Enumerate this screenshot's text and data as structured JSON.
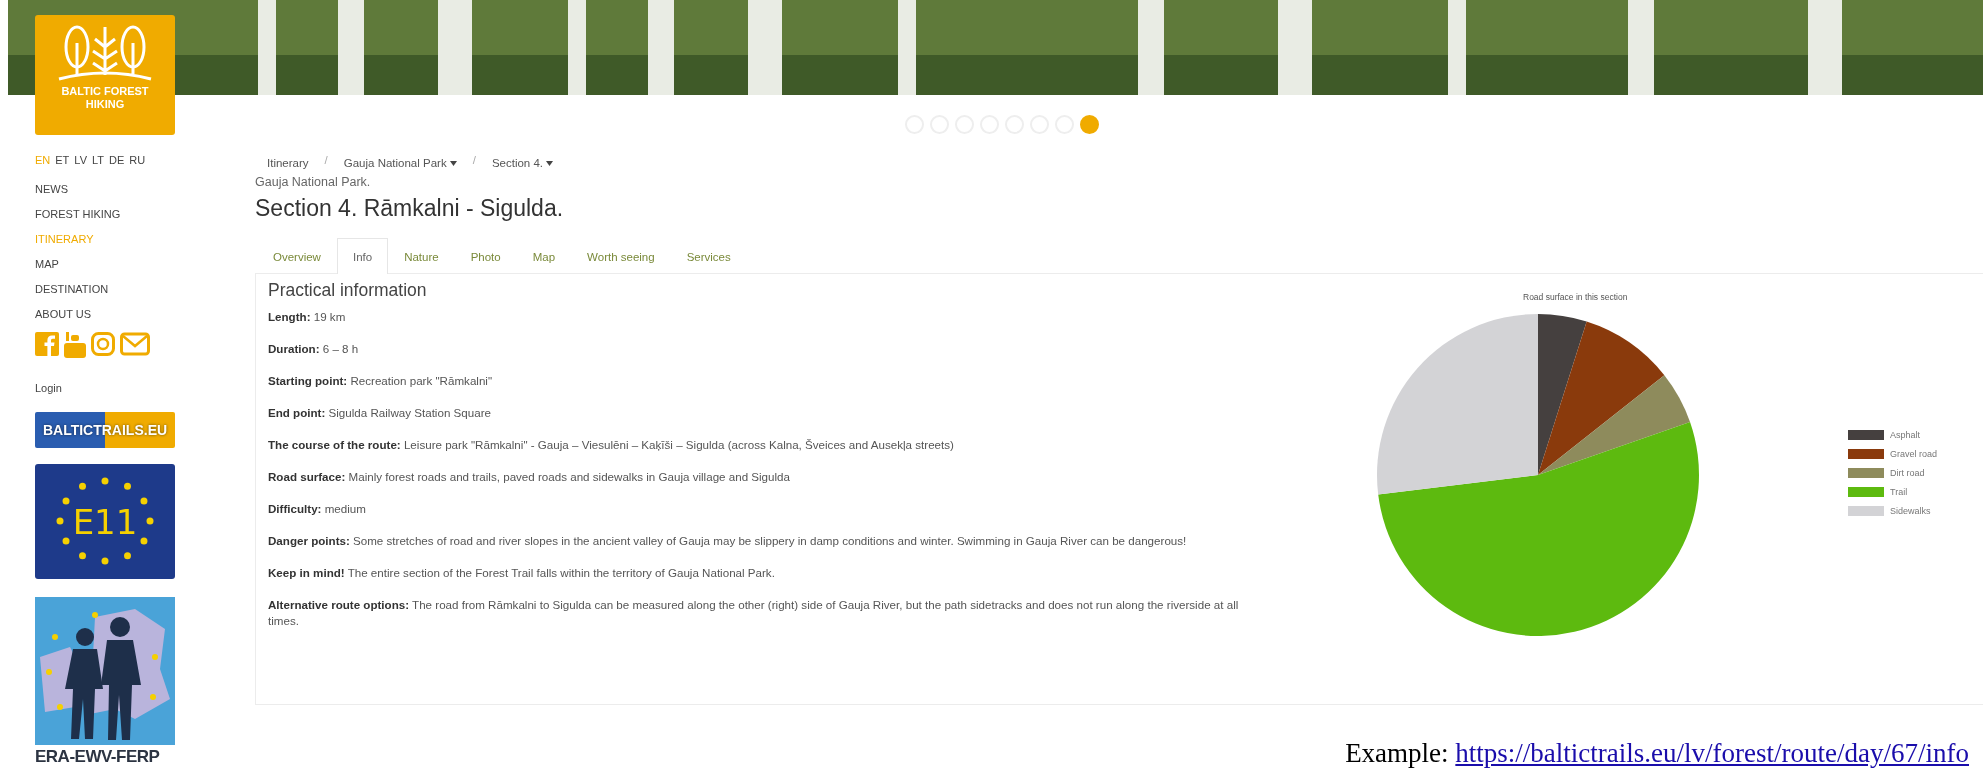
{
  "logo": {
    "lines": [
      "BALTIC FOREST",
      "HIKING"
    ]
  },
  "languages": [
    {
      "label": "EN",
      "selected": true
    },
    {
      "label": "ET",
      "selected": false
    },
    {
      "label": "LV",
      "selected": false
    },
    {
      "label": "LT",
      "selected": false
    },
    {
      "label": "DE",
      "selected": false
    },
    {
      "label": "RU",
      "selected": false
    }
  ],
  "nav": [
    {
      "label": "NEWS",
      "selected": false
    },
    {
      "label": "FOREST HIKING",
      "selected": false
    },
    {
      "label": "ITINERARY",
      "selected": true
    },
    {
      "label": "MAP",
      "selected": false
    },
    {
      "label": "DESTINATION",
      "selected": false
    },
    {
      "label": "ABOUT US",
      "selected": false
    }
  ],
  "login": "Login",
  "partners": {
    "baltictrails": "BALTICTRAILS.EU",
    "e11": "E11",
    "era": "ERA-EWV-FERP"
  },
  "slider_dots": [
    {
      "selected": false
    },
    {
      "selected": false
    },
    {
      "selected": false
    },
    {
      "selected": false
    },
    {
      "selected": false
    },
    {
      "selected": false
    },
    {
      "selected": false
    },
    {
      "selected": true
    }
  ],
  "breadcrumb": [
    {
      "label": "Itinerary",
      "dropdown": false
    },
    {
      "separator": "/",
      "label": "Gauja National Park",
      "dropdown": true
    },
    {
      "separator": "/",
      "label": "Section 4.",
      "dropdown": true
    }
  ],
  "park": "Gauja National Park.",
  "title": "Section 4. Rāmkalni - Sigulda.",
  "tabs": [
    {
      "label": "Overview",
      "selected": false
    },
    {
      "label": "Info",
      "selected": true
    },
    {
      "label": "Nature",
      "selected": false
    },
    {
      "label": "Photo",
      "selected": false
    },
    {
      "label": "Map",
      "selected": false
    },
    {
      "label": "Worth seeing",
      "selected": false
    },
    {
      "label": "Services",
      "selected": false
    }
  ],
  "info": {
    "heading": "Practical information",
    "items": [
      "**Length:** 19 km",
      "**Duration:** 6 – 8 h",
      "**Starting point:** Recreation park \"Rāmkalni\"",
      "**End point:** Sigulda Railway Station Square",
      "**The course of the route:** Leisure park \"Rāmkalni\" - Gauja – Viesulēni – Kaķīši – Sigulda (across Kalna, Šveices and Ausekļa streets)",
      "**Road surface:** Mainly forest roads and trails, paved roads and sidewalks in Gauja village and Sigulda",
      "**Difficulty:** medium",
      "**Danger points:** Some stretches of road and river slopes in the ancient valley of Gauja may be slippery in damp conditions and winter. Swimming in Gauja River can be dangerous!",
      "**Keep in mind!** The entire section of the Forest Trail falls within the territory of Gauja National Park.",
      "**Alternative route options:** The road from Rāmkalni to Sigulda can be measured along the other (right) side of Gauja River, but the path sidetracks and does not run along the riverside at all times."
    ]
  },
  "chart": {
    "title": "Road surface in this section",
    "legend": [
      {
        "label": "Asphalt",
        "color": "#45403f"
      },
      {
        "label": "Gravel road",
        "color": "#8a3a0c"
      },
      {
        "label": "Dirt road",
        "color": "#8e8b5c"
      },
      {
        "label": "Trail",
        "color": "#5dba0f"
      },
      {
        "label": "Sidewalks",
        "color": "#d3d3d6"
      }
    ]
  },
  "note": {
    "label": "Example:",
    "link": "https://baltictrails.eu/lv/forest/route/day/67/info"
  }
}
